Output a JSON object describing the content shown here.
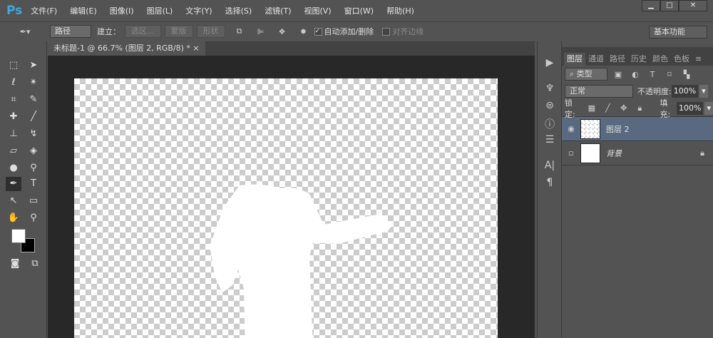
{
  "app": {
    "logo": "Ps"
  },
  "menu": [
    "文件(F)",
    "编辑(E)",
    "图像(I)",
    "图层(L)",
    "文字(Y)",
    "选择(S)",
    "滤镜(T)",
    "视图(V)",
    "窗口(W)",
    "帮助(H)"
  ],
  "window": {
    "minimize": "▁",
    "maximize": "□",
    "close": "✕"
  },
  "options": {
    "mode": "路径",
    "build_label": "建立：",
    "selection": "选区...",
    "mask": "蒙版",
    "shape": "形状",
    "auto_add": "自动添加/删除",
    "auto_add_checked": true,
    "align_edges": "对齐边缘",
    "workspace": "基本功能"
  },
  "document": {
    "tab_title": "未标题-1 @ 66.7% (图层 2, RGB/8) *",
    "close": "×"
  },
  "panel": {
    "tabs": [
      "图层",
      "通道",
      "路径",
      "历史",
      "颜色",
      "色板"
    ],
    "filter": "类型",
    "blend": "正常",
    "opacity_label": "不透明度:",
    "opacity": "100%",
    "lock_label": "锁定:",
    "fill_label": "填充:",
    "fill": "100%",
    "layers": [
      {
        "name": "图层 2",
        "visible": true,
        "selected": true
      },
      {
        "name": "背景",
        "visible": false,
        "selected": false,
        "locked": true
      }
    ]
  }
}
